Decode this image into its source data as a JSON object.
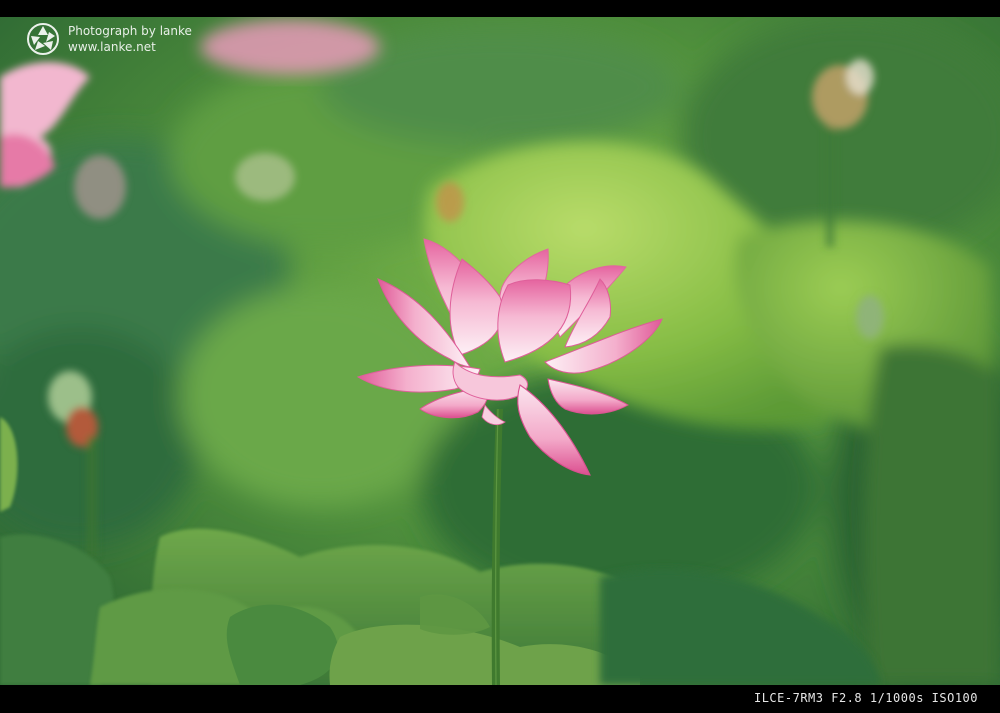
{
  "watermark": {
    "line1": "Photograph by lanke",
    "line2": "www.lanke.net",
    "icon": "camera-aperture-icon"
  },
  "exif": {
    "text": "ILCE-7RM3  F2.8  1/1000s  ISO100"
  },
  "colors": {
    "frame": "#000000",
    "petal_light": "#fbe3ee",
    "petal_pink": "#f08cb8",
    "petal_edge": "#d9488a",
    "stem": "#3f7a2e",
    "leaf_light": "#9bcc52",
    "leaf_dark": "#3f7f38",
    "background": "#4f8a3a"
  }
}
